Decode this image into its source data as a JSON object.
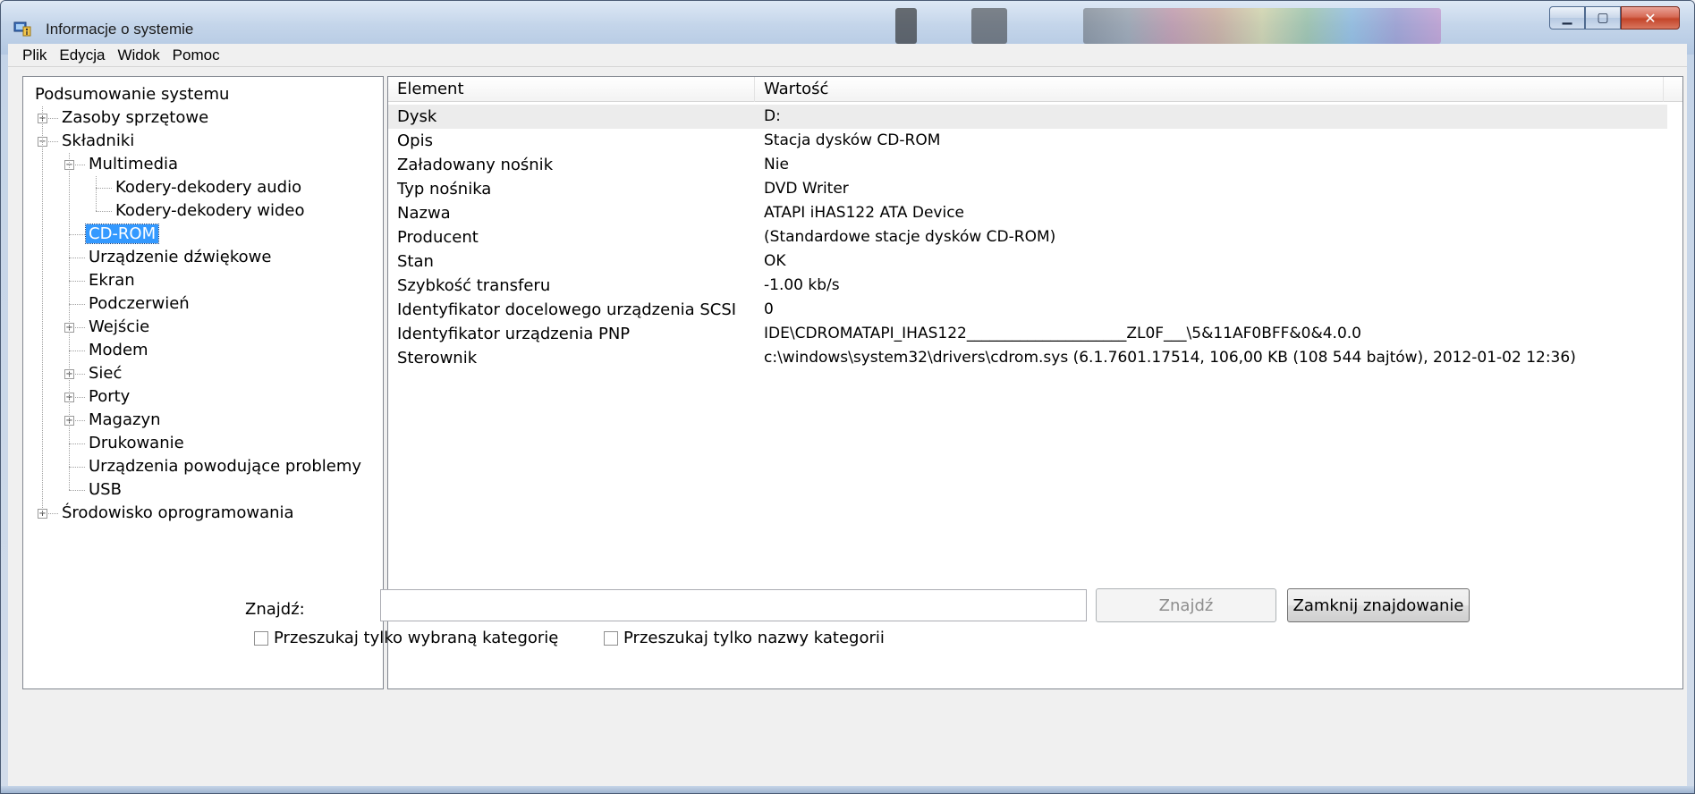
{
  "window": {
    "title": "Informacje o systemie"
  },
  "menubar": {
    "items": [
      "Plik",
      "Edycja",
      "Widok",
      "Pomoc"
    ]
  },
  "tree": [
    {
      "label": "Podsumowanie systemu",
      "level": 0,
      "expander": "none"
    },
    {
      "label": "Zasoby sprzętowe",
      "level": 1,
      "expander": "plus"
    },
    {
      "label": "Składniki",
      "level": 1,
      "expander": "minus"
    },
    {
      "label": "Multimedia",
      "level": 2,
      "expander": "minus"
    },
    {
      "label": "Kodery-dekodery audio",
      "level": 3,
      "expander": "none"
    },
    {
      "label": "Kodery-dekodery wideo",
      "level": 3,
      "expander": "none"
    },
    {
      "label": "CD-ROM",
      "level": 2,
      "expander": "none",
      "selected": true
    },
    {
      "label": "Urządzenie dźwiękowe",
      "level": 2,
      "expander": "none"
    },
    {
      "label": "Ekran",
      "level": 2,
      "expander": "none"
    },
    {
      "label": "Podczerwień",
      "level": 2,
      "expander": "none"
    },
    {
      "label": "Wejście",
      "level": 2,
      "expander": "plus"
    },
    {
      "label": "Modem",
      "level": 2,
      "expander": "none"
    },
    {
      "label": "Sieć",
      "level": 2,
      "expander": "plus"
    },
    {
      "label": "Porty",
      "level": 2,
      "expander": "plus"
    },
    {
      "label": "Magazyn",
      "level": 2,
      "expander": "plus"
    },
    {
      "label": "Drukowanie",
      "level": 2,
      "expander": "none"
    },
    {
      "label": "Urządzenia powodujące problemy",
      "level": 2,
      "expander": "none"
    },
    {
      "label": "USB",
      "level": 2,
      "expander": "none"
    },
    {
      "label": "Środowisko oprogramowania",
      "level": 1,
      "expander": "plus"
    }
  ],
  "list": {
    "columns": [
      "Element",
      "Wartość"
    ],
    "rows": [
      [
        "Dysk",
        "D:"
      ],
      [
        "Opis",
        "Stacja dysków CD-ROM"
      ],
      [
        "Załadowany nośnik",
        "Nie"
      ],
      [
        "Typ nośnika",
        "DVD Writer"
      ],
      [
        "Nazwa",
        "ATAPI iHAS122 ATA Device"
      ],
      [
        "Producent",
        "(Standardowe stacje dysków CD-ROM)"
      ],
      [
        "Stan",
        "OK"
      ],
      [
        "Szybkość transferu",
        "-1.00 kb/s"
      ],
      [
        "Identyfikator docelowego urządzenia SCSI",
        "0"
      ],
      [
        "Identyfikator urządzenia PNP",
        "IDE\\CDROMATAPI_IHAS122_____________________ZL0F___\\5&11AF0BFF&0&4.0.0"
      ],
      [
        "Sterownik",
        "c:\\windows\\system32\\drivers\\cdrom.sys (6.1.7601.17514, 106,00 KB (108 544 bajtów), 2012-01-02 12:36)"
      ]
    ]
  },
  "find": {
    "label": "Znajdź:",
    "value": "",
    "find_button": "Znajdź",
    "close_button": "Zamknij znajdowanie",
    "checkbox_selected_category": "Przeszukaj tylko wybraną kategorię",
    "checkbox_category_names": "Przeszukaj tylko nazwy kategorii"
  }
}
